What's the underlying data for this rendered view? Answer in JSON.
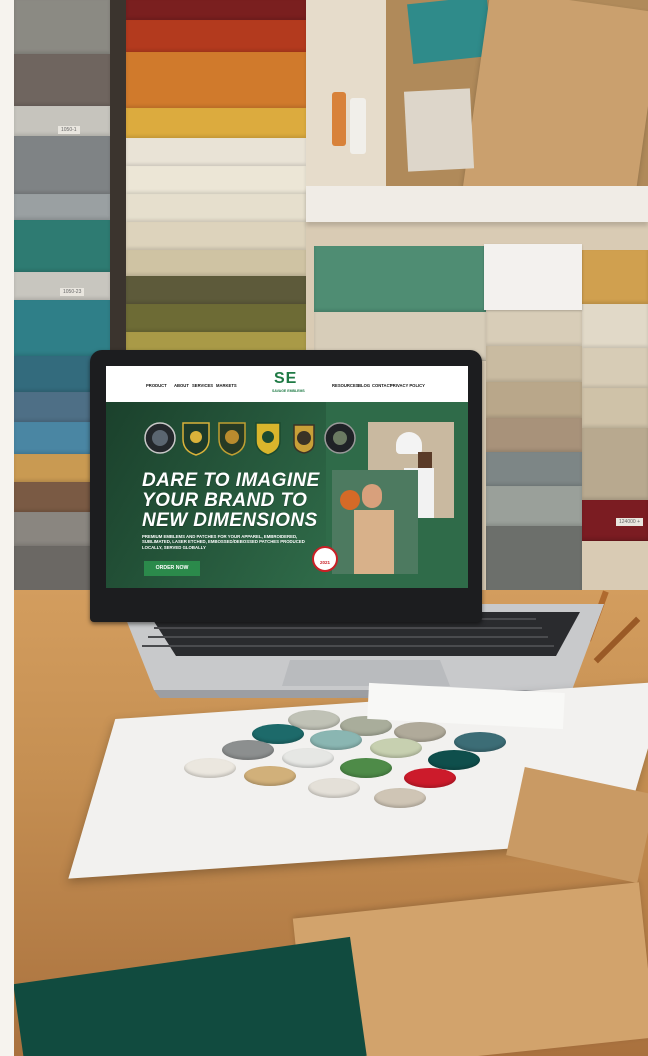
{
  "website": {
    "nav_left": [
      "PRODUCT",
      "ABOUT",
      "SERVICES",
      "MARKETS"
    ],
    "nav_right": [
      "RESOURCES",
      "BLOG",
      "CONTACT",
      "PRIVACY POLICY"
    ],
    "logo_mark": "SE",
    "logo_text": "SAVAGE EMBLEMS",
    "headline": [
      "DARE TO IMAGINE",
      "YOUR BRAND TO",
      "NEW DIMENSIONS"
    ],
    "subtext": "PREMIUM EMBLEMS AND PATCHES FOR YOUR APPAREL, EMBROIDERED, SUBLIMATED, LASER ETCHED, EMBOSSED/DEBOSSED PATCHES PRODUCED LOCALLY, SERVED GLOBALLY",
    "cta": "ORDER NOW",
    "award_year": "2021"
  },
  "labels": {
    "swatch_tag_1": "1050-1",
    "swatch_tag_2": "1050-23",
    "box_label": "124000 +"
  },
  "colors": {
    "brand_green": "#2f6b49",
    "cta_green": "#2b8a4b",
    "paper": "#f2f1ef",
    "desk": "#c18e54"
  }
}
